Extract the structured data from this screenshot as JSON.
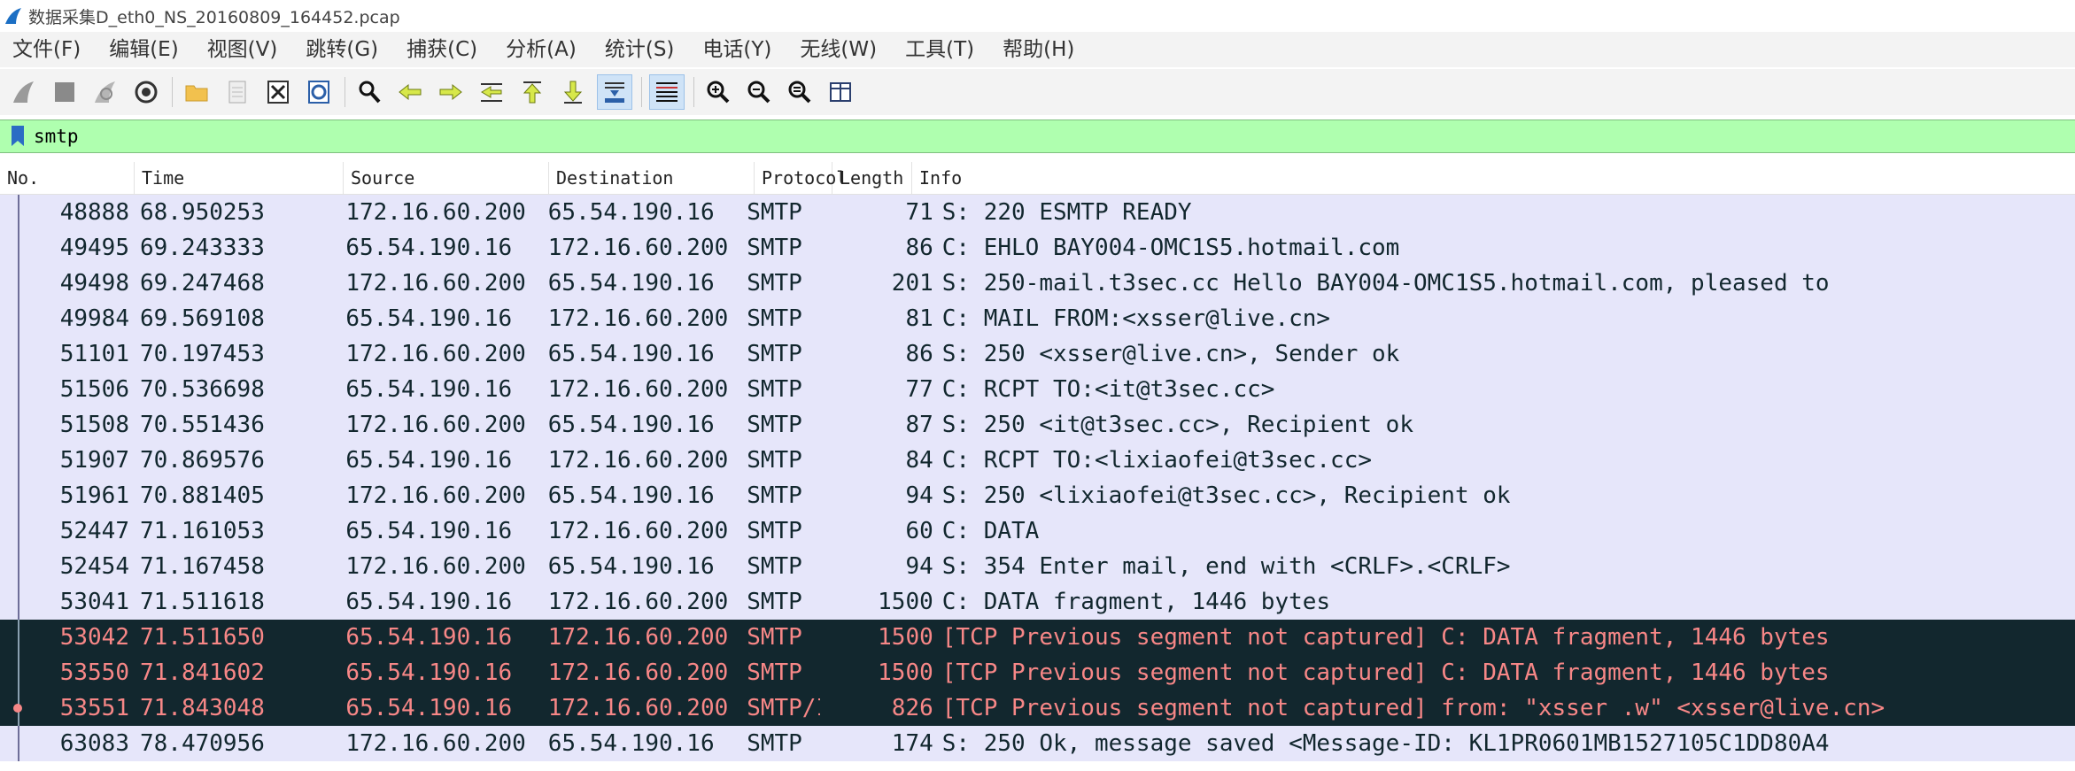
{
  "window": {
    "title": "数据采集D_eth0_NS_20160809_164452.pcap"
  },
  "menu": [
    "文件(F)",
    "编辑(E)",
    "视图(V)",
    "跳转(G)",
    "捕获(C)",
    "分析(A)",
    "统计(S)",
    "电话(Y)",
    "无线(W)",
    "工具(T)",
    "帮助(H)"
  ],
  "toolbar": {
    "icons": [
      "shark-fin-start-icon",
      "stop-square-icon",
      "restart-shark-icon",
      "capture-options-gear-icon",
      "open-folder-icon",
      "save-file-icon",
      "close-file-icon",
      "reload-icon",
      "find-packet-icon",
      "go-back-arrow-icon",
      "go-forward-arrow-icon",
      "go-to-packet-icon",
      "first-packet-icon",
      "last-packet-icon",
      "autoscroll-icon",
      "colorize-icon",
      "zoom-in-icon",
      "zoom-out-icon",
      "normal-size-icon",
      "resize-columns-icon"
    ],
    "active": [
      "autoscroll-icon",
      "colorize-icon"
    ]
  },
  "filter": {
    "value": "smtp"
  },
  "columns": [
    "No.",
    "Time",
    "Source",
    "Destination",
    "Protocol",
    "Length",
    "Info"
  ],
  "colors": {
    "normal_bg": "#e6e6fa",
    "normal_fg": "#12272e",
    "bad_bg": "#12272e",
    "bad_fg": "#f78787",
    "filter_bg": "#afffaf"
  },
  "packets": [
    {
      "no": "48888",
      "time": "68.950253",
      "src": "172.16.60.200",
      "dst": "65.54.190.16",
      "proto": "SMTP",
      "len": "71",
      "info": "S: 220 ESMTP READY",
      "style": "normal"
    },
    {
      "no": "49495",
      "time": "69.243333",
      "src": "65.54.190.16",
      "dst": "172.16.60.200",
      "proto": "SMTP",
      "len": "86",
      "info": "C: EHLO BAY004-OMC1S5.hotmail.com",
      "style": "normal"
    },
    {
      "no": "49498",
      "time": "69.247468",
      "src": "172.16.60.200",
      "dst": "65.54.190.16",
      "proto": "SMTP",
      "len": "201",
      "info": "S: 250-mail.t3sec.cc Hello BAY004-OMC1S5.hotmail.com, pleased to",
      "style": "normal"
    },
    {
      "no": "49984",
      "time": "69.569108",
      "src": "65.54.190.16",
      "dst": "172.16.60.200",
      "proto": "SMTP",
      "len": "81",
      "info": "C: MAIL FROM:<xsser@live.cn>",
      "style": "normal"
    },
    {
      "no": "51101",
      "time": "70.197453",
      "src": "172.16.60.200",
      "dst": "65.54.190.16",
      "proto": "SMTP",
      "len": "86",
      "info": "S: 250 <xsser@live.cn>, Sender ok",
      "style": "normal"
    },
    {
      "no": "51506",
      "time": "70.536698",
      "src": "65.54.190.16",
      "dst": "172.16.60.200",
      "proto": "SMTP",
      "len": "77",
      "info": "C: RCPT TO:<it@t3sec.cc>",
      "style": "normal"
    },
    {
      "no": "51508",
      "time": "70.551436",
      "src": "172.16.60.200",
      "dst": "65.54.190.16",
      "proto": "SMTP",
      "len": "87",
      "info": "S: 250 <it@t3sec.cc>, Recipient ok",
      "style": "normal"
    },
    {
      "no": "51907",
      "time": "70.869576",
      "src": "65.54.190.16",
      "dst": "172.16.60.200",
      "proto": "SMTP",
      "len": "84",
      "info": "C: RCPT TO:<lixiaofei@t3sec.cc>",
      "style": "normal"
    },
    {
      "no": "51961",
      "time": "70.881405",
      "src": "172.16.60.200",
      "dst": "65.54.190.16",
      "proto": "SMTP",
      "len": "94",
      "info": "S: 250 <lixiaofei@t3sec.cc>, Recipient ok",
      "style": "normal"
    },
    {
      "no": "52447",
      "time": "71.161053",
      "src": "65.54.190.16",
      "dst": "172.16.60.200",
      "proto": "SMTP",
      "len": "60",
      "info": "C: DATA",
      "style": "normal"
    },
    {
      "no": "52454",
      "time": "71.167458",
      "src": "172.16.60.200",
      "dst": "65.54.190.16",
      "proto": "SMTP",
      "len": "94",
      "info": "S: 354 Enter mail, end with <CRLF>.<CRLF>",
      "style": "normal"
    },
    {
      "no": "53041",
      "time": "71.511618",
      "src": "65.54.190.16",
      "dst": "172.16.60.200",
      "proto": "SMTP",
      "len": "1500",
      "info": "C: DATA fragment, 1446 bytes",
      "style": "normal"
    },
    {
      "no": "53042",
      "time": "71.511650",
      "src": "65.54.190.16",
      "dst": "172.16.60.200",
      "proto": "SMTP",
      "len": "1500",
      "info": "[TCP Previous segment not captured] C: DATA fragment, 1446 bytes",
      "style": "bad"
    },
    {
      "no": "53550",
      "time": "71.841602",
      "src": "65.54.190.16",
      "dst": "172.16.60.200",
      "proto": "SMTP",
      "len": "1500",
      "info": "[TCP Previous segment not captured] C: DATA fragment, 1446 bytes",
      "style": "bad"
    },
    {
      "no": "53551",
      "time": "71.843048",
      "src": "65.54.190.16",
      "dst": "172.16.60.200",
      "proto": "SMTP/I…",
      "len": "826",
      "info": "[TCP Previous segment not captured] from: \"xsser .w\" <xsser@live.cn>",
      "style": "bad",
      "marker": true
    },
    {
      "no": "63083",
      "time": "78.470956",
      "src": "172.16.60.200",
      "dst": "65.54.190.16",
      "proto": "SMTP",
      "len": "174",
      "info": "S: 250 Ok, message saved <Message-ID: KL1PR0601MB1527105C1DD80A4",
      "style": "normal"
    }
  ]
}
